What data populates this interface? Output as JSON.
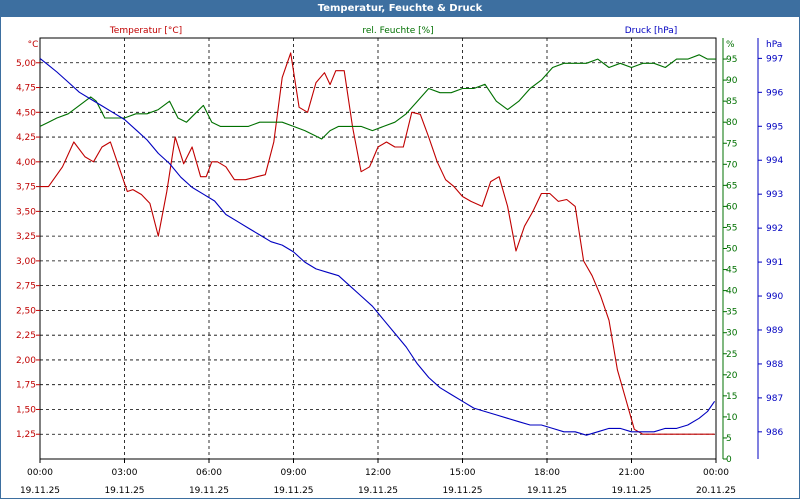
{
  "window": {
    "title": "Temperatur, Feuchte & Druck"
  },
  "chart_data": {
    "type": "line",
    "title": "Temperatur, Feuchte & Druck",
    "grid": true,
    "colors": {
      "temperature": "#c00000",
      "humidity": "#007000",
      "pressure": "#0000c0"
    },
    "x_ticks": [
      {
        "time": "00:00",
        "date": "19.11.25"
      },
      {
        "time": "03:00",
        "date": "19.11.25"
      },
      {
        "time": "06:00",
        "date": "19.11.25"
      },
      {
        "time": "09:00",
        "date": "19.11.25"
      },
      {
        "time": "12:00",
        "date": "19.11.25"
      },
      {
        "time": "15:00",
        "date": "19.11.25"
      },
      {
        "time": "18:00",
        "date": "19.11.25"
      },
      {
        "time": "21:00",
        "date": "19.11.25"
      },
      {
        "time": "00:00",
        "date": "20.11.25"
      }
    ],
    "x_range_hours": [
      0,
      24
    ],
    "axes": {
      "temperature": {
        "unit_label": "°C",
        "legend": "Temperatur [°C]",
        "range": [
          1.0,
          5.25
        ],
        "ticks": [
          "1,25",
          "1,50",
          "1,75",
          "2,00",
          "2,25",
          "2,50",
          "2,75",
          "3,00",
          "3,25",
          "3,50",
          "3,75",
          "4,00",
          "4,25",
          "4,50",
          "4,75",
          "5,00"
        ],
        "tick_values": [
          1.25,
          1.5,
          1.75,
          2.0,
          2.25,
          2.5,
          2.75,
          3.0,
          3.25,
          3.5,
          3.75,
          4.0,
          4.25,
          4.5,
          4.75,
          5.0
        ]
      },
      "humidity": {
        "unit_label": "%",
        "legend": "rel. Feuchte [%]",
        "range": [
          0,
          100
        ],
        "ticks": [
          "0",
          "5",
          "10",
          "15",
          "20",
          "25",
          "30",
          "35",
          "40",
          "45",
          "50",
          "55",
          "60",
          "65",
          "70",
          "75",
          "80",
          "85",
          "90",
          "95",
          "%"
        ],
        "tick_values": [
          0,
          5,
          10,
          15,
          20,
          25,
          30,
          35,
          40,
          45,
          50,
          55,
          60,
          65,
          70,
          75,
          80,
          85,
          90,
          95
        ]
      },
      "pressure": {
        "unit_label": "hPa",
        "legend": "Druck [hPa]",
        "range": [
          985.2,
          997.6
        ],
        "ticks": [
          "986",
          "987",
          "988",
          "989",
          "990",
          "991",
          "992",
          "993",
          "994",
          "995",
          "996",
          "997"
        ],
        "tick_values": [
          986,
          987,
          988,
          989,
          990,
          991,
          992,
          993,
          994,
          995,
          996,
          997
        ]
      }
    },
    "series": [
      {
        "name": "Temperatur [°C]",
        "axis": "temperature",
        "x": [
          0,
          0.3,
          0.8,
          1.2,
          1.6,
          1.9,
          2.2,
          2.5,
          2.8,
          3.1,
          3.3,
          3.6,
          3.9,
          4.2,
          4.5,
          4.8,
          5.1,
          5.4,
          5.7,
          5.9,
          6.1,
          6.3,
          6.6,
          6.9,
          7.3,
          7.7,
          8.0,
          8.3,
          8.6,
          8.9,
          9.2,
          9.5,
          9.8,
          10.1,
          10.3,
          10.5,
          10.8,
          11.1,
          11.4,
          11.7,
          12.0,
          12.3,
          12.6,
          12.9,
          13.2,
          13.5,
          13.8,
          14.1,
          14.4,
          14.7,
          15.0,
          15.3,
          15.7,
          16.0,
          16.3,
          16.6,
          16.9,
          17.2,
          17.5,
          17.8,
          18.1,
          18.4,
          18.7,
          19.0,
          19.3,
          19.6,
          19.9,
          20.2,
          20.5,
          20.8,
          21.1,
          21.4,
          21.7,
          22.0,
          22.3,
          22.6,
          22.9,
          23.2,
          23.5,
          23.7,
          23.85,
          23.95
        ],
        "y": [
          3.75,
          3.75,
          3.95,
          4.2,
          4.05,
          4.0,
          4.15,
          4.2,
          3.95,
          3.7,
          3.72,
          3.67,
          3.58,
          3.25,
          3.7,
          4.25,
          3.98,
          4.15,
          3.85,
          3.85,
          4.0,
          4.0,
          3.95,
          3.82,
          3.82,
          3.85,
          3.87,
          4.2,
          4.85,
          5.1,
          4.55,
          4.5,
          4.8,
          4.9,
          4.78,
          4.92,
          4.92,
          4.35,
          3.9,
          3.95,
          4.15,
          4.2,
          4.15,
          4.15,
          4.5,
          4.48,
          4.25,
          4.0,
          3.82,
          3.75,
          3.65,
          3.6,
          3.55,
          3.8,
          3.85,
          3.55,
          3.1,
          3.35,
          3.5,
          3.68,
          3.68,
          3.6,
          3.62,
          3.55,
          3.0,
          2.85,
          2.65,
          2.4,
          1.9,
          1.6,
          1.3,
          1.25,
          1.25,
          1.25,
          1.25,
          1.25,
          1.25,
          1.25,
          1.25,
          1.25,
          1.25,
          1.25
        ]
      },
      {
        "name": "rel. Feuchte [%]",
        "axis": "humidity",
        "x": [
          0,
          0.3,
          0.6,
          1.0,
          1.4,
          1.8,
          2.0,
          2.3,
          2.6,
          3.0,
          3.4,
          3.8,
          4.2,
          4.6,
          4.9,
          5.2,
          5.5,
          5.8,
          6.1,
          6.4,
          6.7,
          7.0,
          7.4,
          7.8,
          8.2,
          8.6,
          9.0,
          9.4,
          9.7,
          10.0,
          10.3,
          10.6,
          11.0,
          11.4,
          11.8,
          12.2,
          12.6,
          13.0,
          13.4,
          13.8,
          14.2,
          14.6,
          15.0,
          15.4,
          15.8,
          16.2,
          16.6,
          17.0,
          17.4,
          17.8,
          18.2,
          18.6,
          19.0,
          19.4,
          19.8,
          20.2,
          20.6,
          21.0,
          21.4,
          21.8,
          22.2,
          22.6,
          23.0,
          23.4,
          23.7,
          24.0
        ],
        "y": [
          79,
          80,
          81,
          82,
          84,
          86,
          85,
          81,
          81,
          81,
          82,
          82,
          83,
          85,
          81,
          80,
          82,
          84,
          80,
          79,
          79,
          79,
          79,
          80,
          80,
          80,
          79,
          78,
          77,
          76,
          78,
          79,
          79,
          79,
          78,
          79,
          80,
          82,
          85,
          88,
          87,
          87,
          88,
          88,
          89,
          85,
          83,
          85,
          88,
          90,
          93,
          94,
          94,
          94,
          95,
          93,
          94,
          93,
          94,
          94,
          93,
          95,
          95,
          96,
          95,
          95
        ]
      },
      {
        "name": "Druck [hPa]",
        "axis": "pressure",
        "x": [
          0,
          0.3,
          0.6,
          1.0,
          1.4,
          1.8,
          2.2,
          2.6,
          3.0,
          3.4,
          3.8,
          4.2,
          4.6,
          5.0,
          5.4,
          5.8,
          6.2,
          6.6,
          7.0,
          7.4,
          7.8,
          8.2,
          8.6,
          9.0,
          9.4,
          9.8,
          10.2,
          10.6,
          11.0,
          11.4,
          11.8,
          12.2,
          12.6,
          13.0,
          13.4,
          13.8,
          14.2,
          14.6,
          15.0,
          15.4,
          15.8,
          16.2,
          16.6,
          17.0,
          17.4,
          17.8,
          18.2,
          18.6,
          19.0,
          19.4,
          19.8,
          20.2,
          20.6,
          21.0,
          21.4,
          21.8,
          22.2,
          22.6,
          23.0,
          23.4,
          23.7,
          23.95
        ],
        "y": [
          997.0,
          996.8,
          996.6,
          996.3,
          996.0,
          995.8,
          995.6,
          995.4,
          995.2,
          994.9,
          994.6,
          994.2,
          993.9,
          993.5,
          993.2,
          993.0,
          992.8,
          992.4,
          992.2,
          992.0,
          991.8,
          991.6,
          991.5,
          991.3,
          991.0,
          990.8,
          990.7,
          990.6,
          990.3,
          990.0,
          989.7,
          989.3,
          988.9,
          988.5,
          988.0,
          987.6,
          987.3,
          987.1,
          986.9,
          986.7,
          986.6,
          986.5,
          986.4,
          986.3,
          986.2,
          986.2,
          986.1,
          986.0,
          986.0,
          985.9,
          986.0,
          986.1,
          986.1,
          986.0,
          986.0,
          986.0,
          986.1,
          986.1,
          986.2,
          986.4,
          986.6,
          986.9
        ]
      }
    ]
  }
}
